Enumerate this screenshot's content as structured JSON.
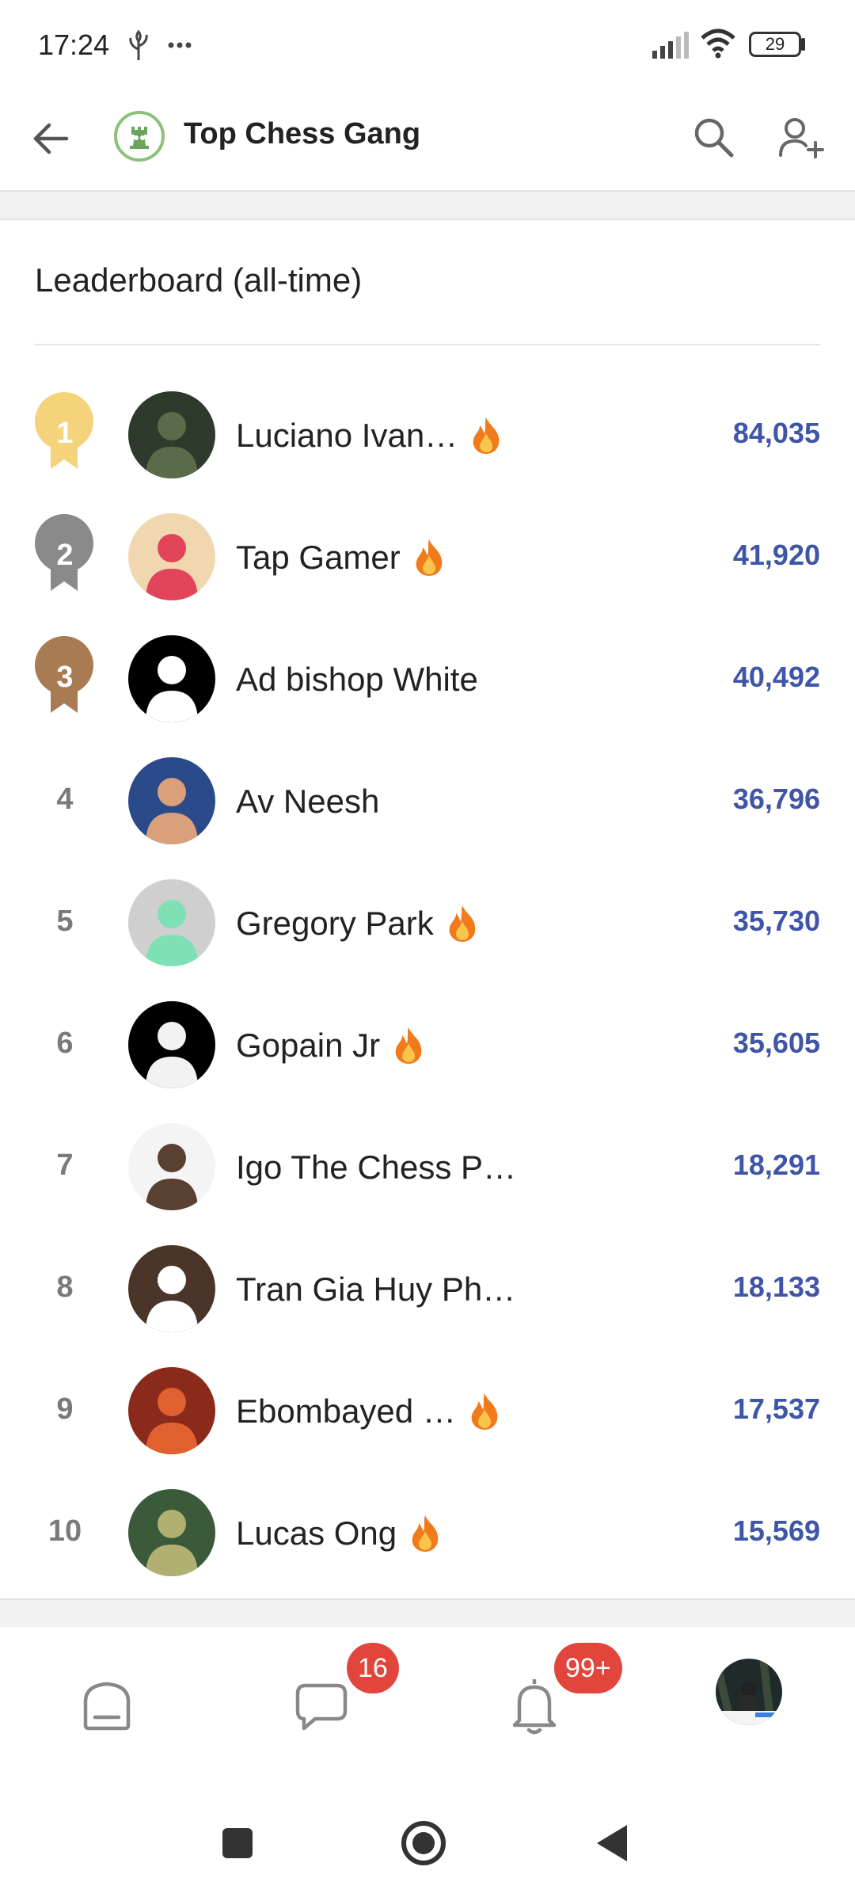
{
  "status_bar": {
    "time": "17:24",
    "battery": "29"
  },
  "header": {
    "title": "Top Chess Gang"
  },
  "leaderboard": {
    "title": "Leaderboard (all-time)",
    "entries": [
      {
        "rank": "1",
        "name": "Luciano Ivan…",
        "score": "84,035",
        "streak": true,
        "medal": "gold"
      },
      {
        "rank": "2",
        "name": "Tap Gamer",
        "score": "41,920",
        "streak": true,
        "medal": "silver"
      },
      {
        "rank": "3",
        "name": "Ad bishop White",
        "score": "40,492",
        "streak": false,
        "medal": "bronze"
      },
      {
        "rank": "4",
        "name": "Av Neesh",
        "score": "36,796",
        "streak": false
      },
      {
        "rank": "5",
        "name": "Gregory Park",
        "score": "35,730",
        "streak": true
      },
      {
        "rank": "6",
        "name": "Gopain Jr",
        "score": "35,605",
        "streak": true
      },
      {
        "rank": "7",
        "name": "Igo The Chess P…",
        "score": "18,291",
        "streak": false
      },
      {
        "rank": "8",
        "name": "Tran Gia Huy Ph…",
        "score": "18,133",
        "streak": false
      },
      {
        "rank": "9",
        "name": "Ebombayed …",
        "score": "17,537",
        "streak": true
      },
      {
        "rank": "10",
        "name": "Lucas Ong",
        "score": "15,569",
        "streak": true
      }
    ]
  },
  "bottom_nav": {
    "chat_badge": "16",
    "notifications_badge": "99+"
  },
  "colors": {
    "score": "#3e55a8",
    "gold": "#f5d37a",
    "silver": "#8a8a8a",
    "bronze": "#a87b52",
    "badge": "#e2453c"
  },
  "icons": [
    "back-arrow-icon",
    "search-icon",
    "add-member-icon",
    "fire-icon",
    "home-icon",
    "chat-icon",
    "bell-icon",
    "square-icon",
    "circle-icon",
    "triangle-back-icon"
  ]
}
